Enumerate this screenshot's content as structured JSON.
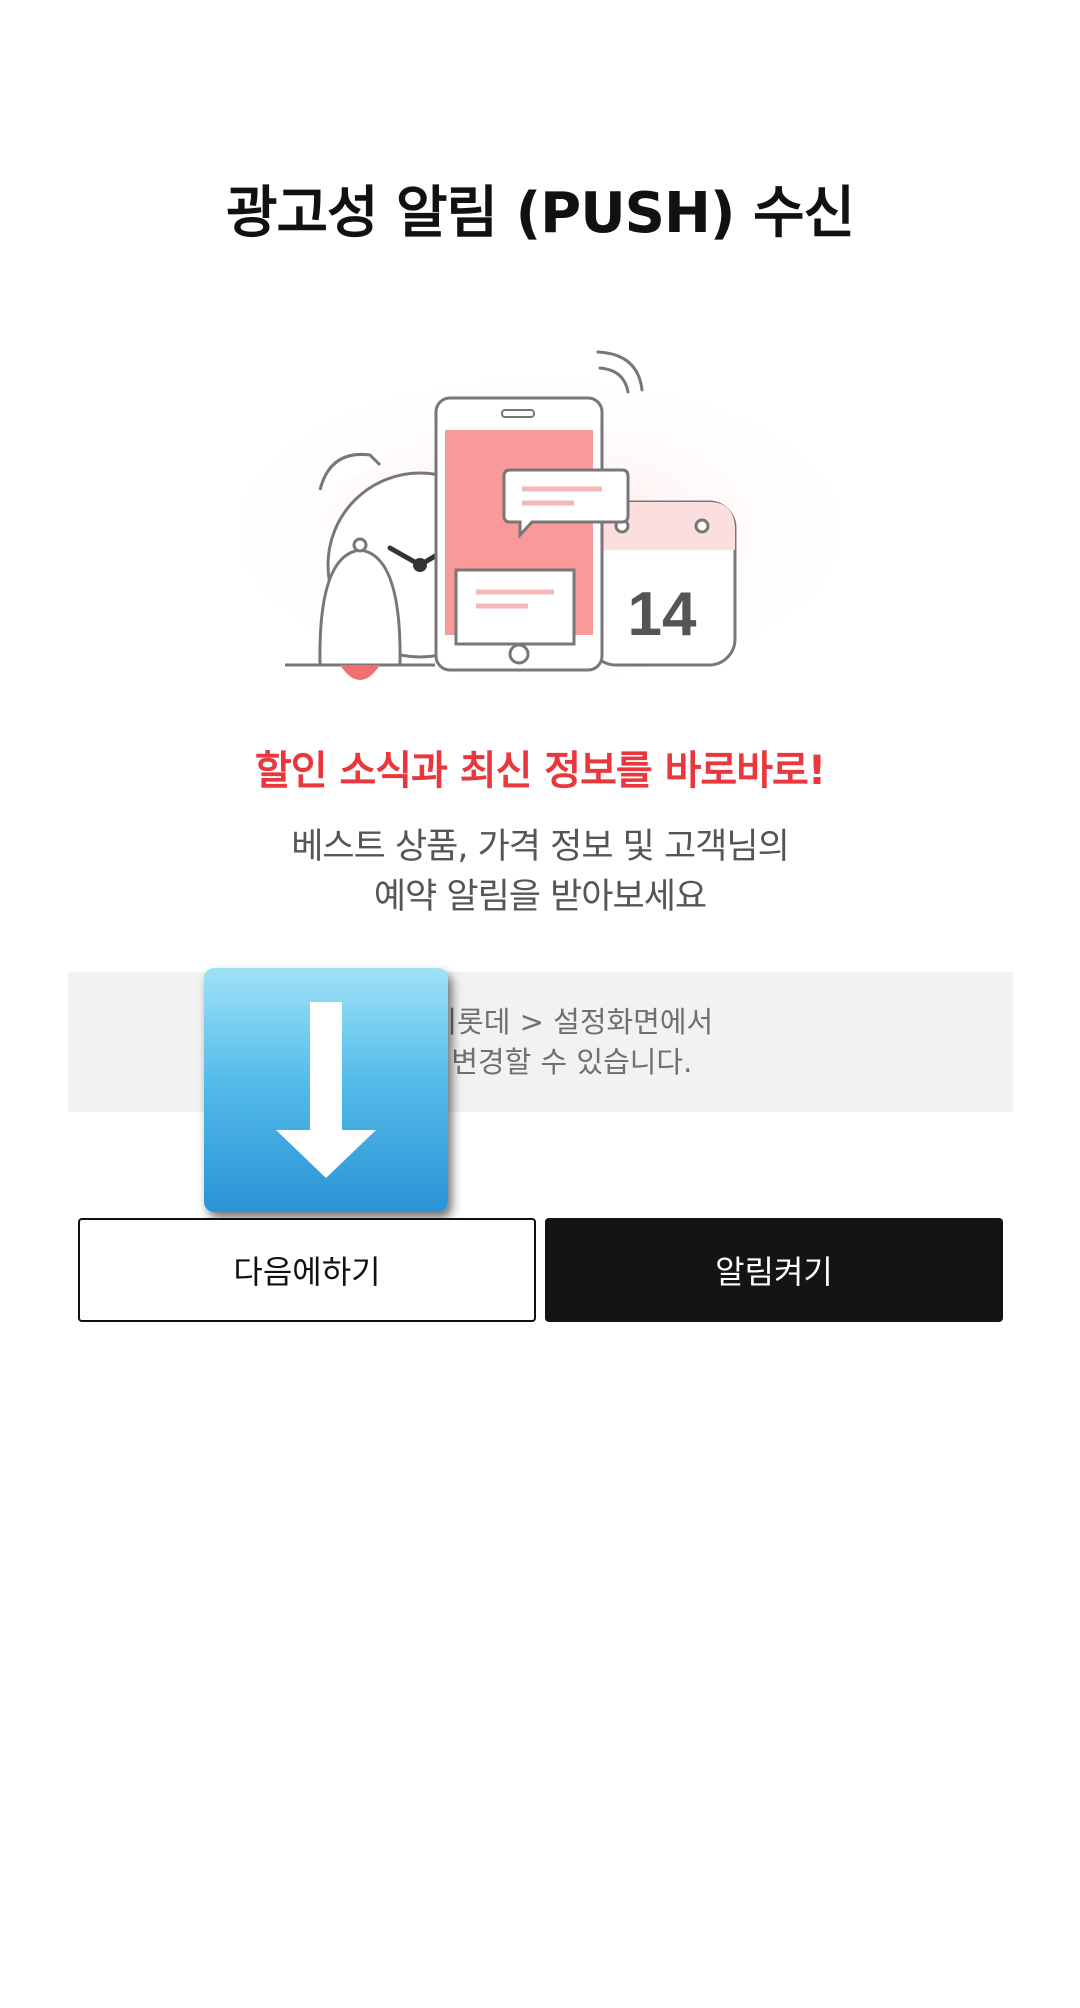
{
  "page": {
    "title": "광고성 알림 (PUSH) 수신"
  },
  "illustration": {
    "calendar_day": "14",
    "colors": {
      "accent_pink": "#f89a9a",
      "line_gray": "#777777",
      "bell_red": "#f07070"
    }
  },
  "content": {
    "headline": "할인 소식과 최신 정보를 바로바로!",
    "subtitle_line1": "베스트 상품, 가격 정보 및 고객님의",
    "subtitle_line2": "예약 알림을 받아보세요"
  },
  "notice": {
    "line1": "은 마이롯데 > 설정화면에서",
    "line2": "라도 변경할 수 있습니다."
  },
  "overlay": {
    "icon": "down-arrow-icon",
    "colors": {
      "top": "#9fe2f7",
      "bottom": "#2a93d5"
    }
  },
  "buttons": {
    "later_label": "다음에하기",
    "enable_label": "알림켜기"
  },
  "colors": {
    "headline_red": "#e8383d",
    "primary_button": "#141414"
  }
}
